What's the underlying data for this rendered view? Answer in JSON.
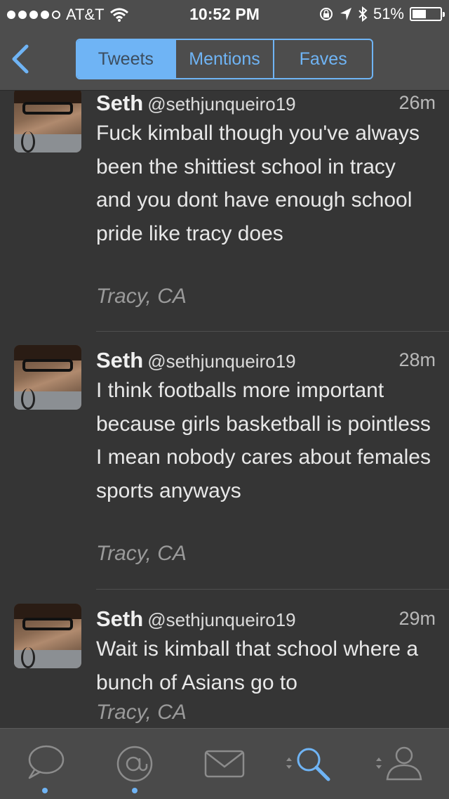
{
  "status_bar": {
    "carrier": "AT&T",
    "time": "10:52 PM",
    "battery": "51%",
    "battery_level": 0.51
  },
  "nav": {
    "segments": [
      "Tweets",
      "Mentions",
      "Faves"
    ],
    "selected": "Tweets"
  },
  "tweets": [
    {
      "name": "Seth",
      "handle": "@sethjunqueiro19",
      "time": "26m",
      "text": "Fuck kimball though you've always been the shittiest school in tracy and you dont have enough school pride like tracy does",
      "location": "Tracy, CA"
    },
    {
      "name": "Seth",
      "handle": "@sethjunqueiro19",
      "time": "28m",
      "text": "I think footballs more important because girls basketball is pointless I mean nobody cares about females sports anyways",
      "location": "Tracy, CA"
    },
    {
      "name": "Seth",
      "handle": "@sethjunqueiro19",
      "time": "29m",
      "text": "Wait is kimball that school where a bunch of Asians go to",
      "location": "Tracy, CA"
    }
  ],
  "tabbar": {
    "icons": [
      "speech-bubble-icon",
      "at-sign-icon",
      "envelope-icon",
      "search-icon",
      "profile-icon"
    ],
    "active_color": "#6fb4f5"
  }
}
